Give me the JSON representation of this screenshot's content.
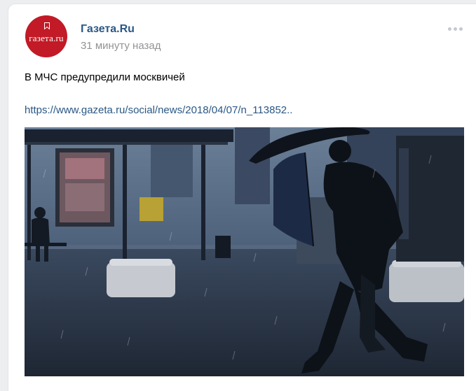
{
  "post": {
    "author": "Газета.Ru",
    "time": "31 минуту назад",
    "avatar_text": "газета.ru",
    "text": "В МЧС предупредили москвичей",
    "link": "https://www.gazeta.ru/social/news/2018/04/07/n_113852..",
    "more_icon": "more-horizontal-icon"
  },
  "colors": {
    "author": "#2a5885",
    "brand": "#c21a26",
    "muted": "#939393"
  }
}
